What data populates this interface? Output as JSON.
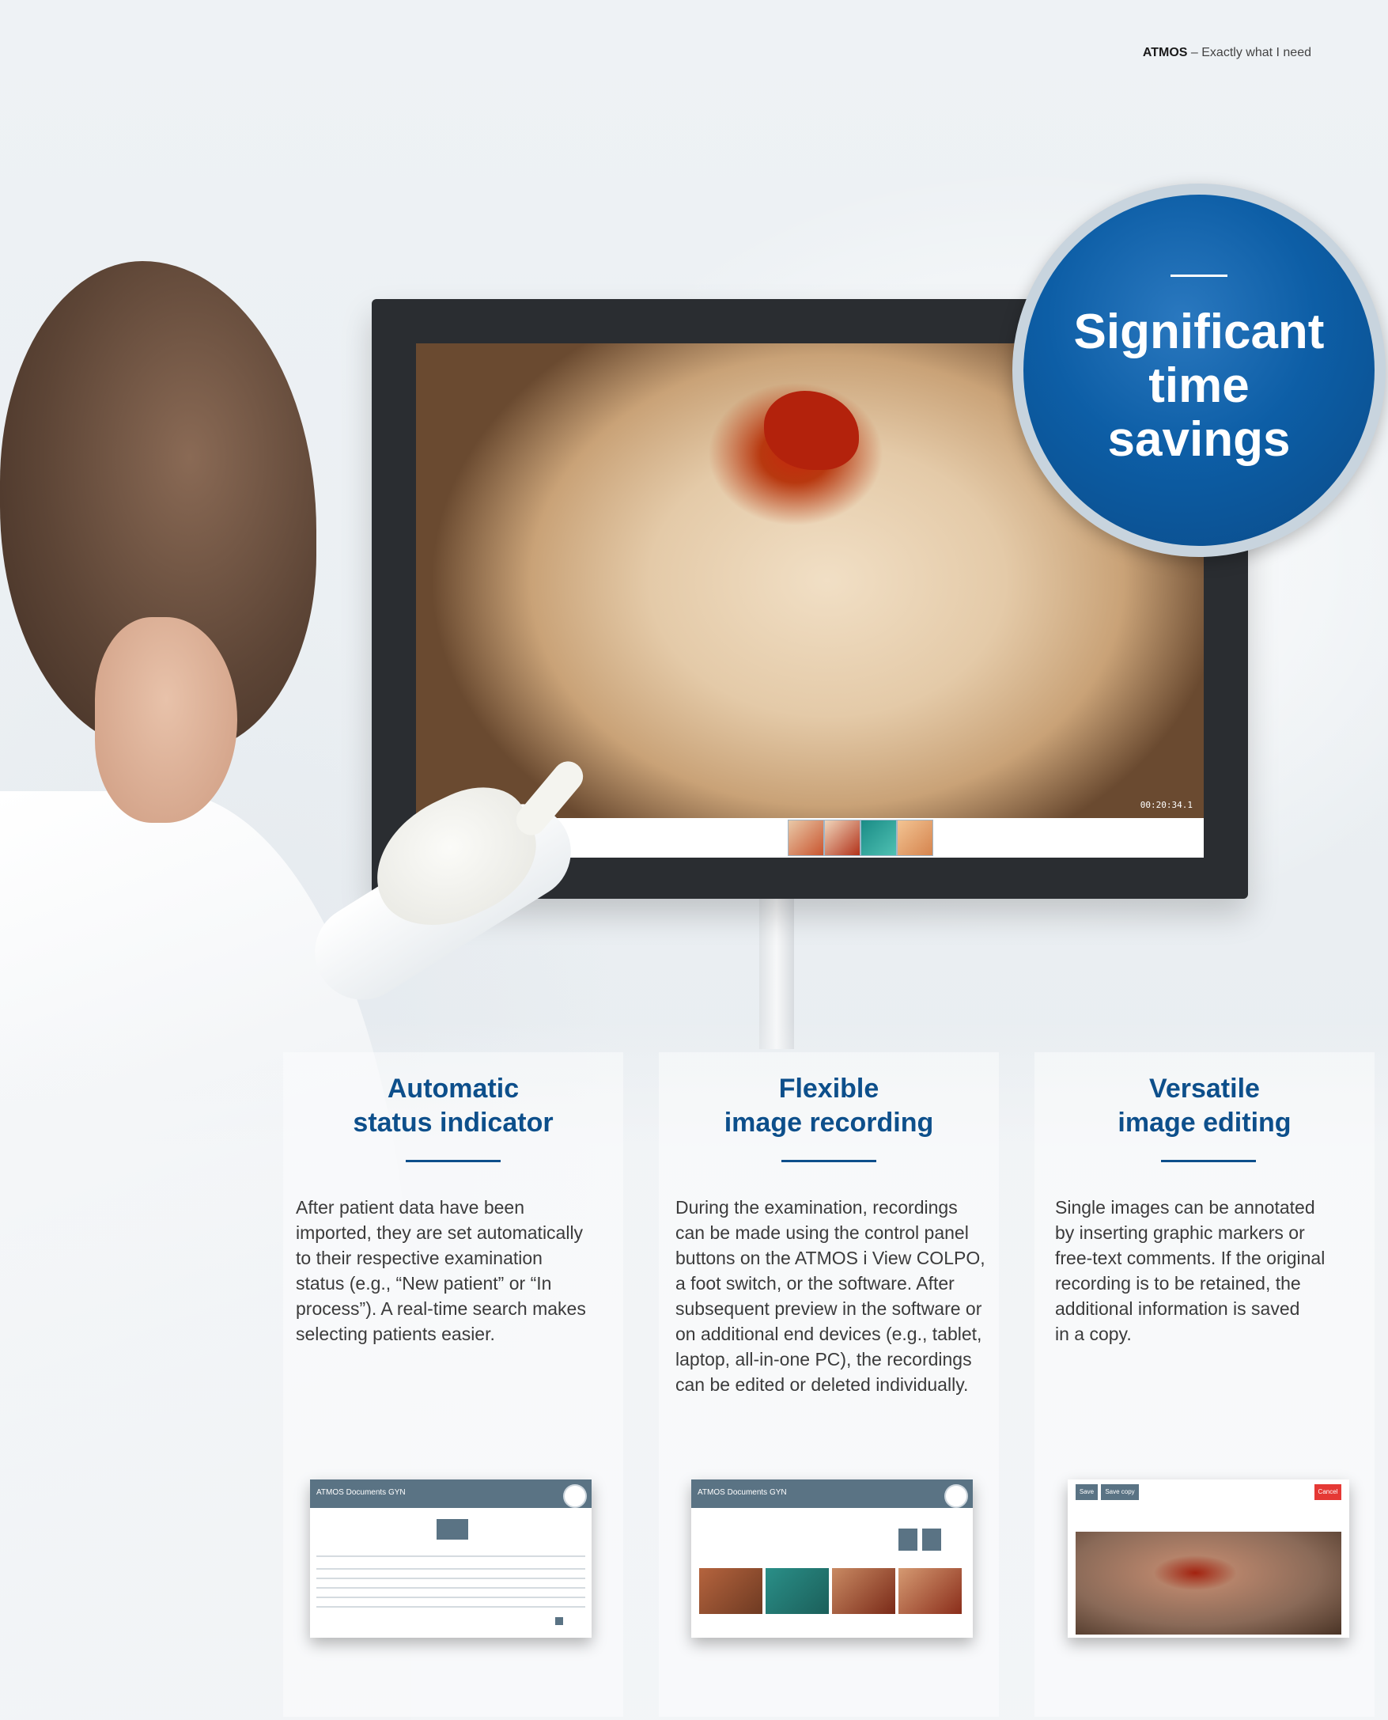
{
  "header": {
    "brand": "ATMOS",
    "separator": "–",
    "tagline": "Exactly what I need"
  },
  "badge": {
    "text": "Significant\ntime\nsavings"
  },
  "monitor": {
    "timestamp": "00:20:34.1"
  },
  "columns": [
    {
      "title": "Automatic\nstatus indicator",
      "body": "After patient data have been\nimported, they are set automatically\nto their respective examination\nstatus (e.g., “New patient” or “In\nprocess”). A real-time search makes\nselecting patients easier."
    },
    {
      "title": "Flexible\nimage recording",
      "body": "During the examination, recordings\ncan be made using the control panel\nbuttons on the ATMOS i View COLPO,\na foot switch, or the software. After\nsubsequent preview in the software or\non additional end devices (e.g., tablet,\nlaptop, all-in-one PC), the recordings\ncan be edited or deleted individually."
    },
    {
      "title": "Versatile\nimage editing",
      "body": "Single images can be annotated\nby inserting graphic markers or\nfree-text comments. If the original\nrecording is to be retained, the\nadditional information is saved\nin a copy."
    }
  ],
  "screenshots": {
    "app1_title": "ATMOS Documents GYN",
    "app2_title": "ATMOS Documents GYN",
    "app3_save": "Save",
    "app3_save_copy": "Save copy",
    "app3_cancel": "Cancel"
  },
  "colors": {
    "brand_blue": "#0d4f8b",
    "badge_blue": "#0d5ea6",
    "app_bar": "#5a7384",
    "cancel_red": "#e53935"
  }
}
